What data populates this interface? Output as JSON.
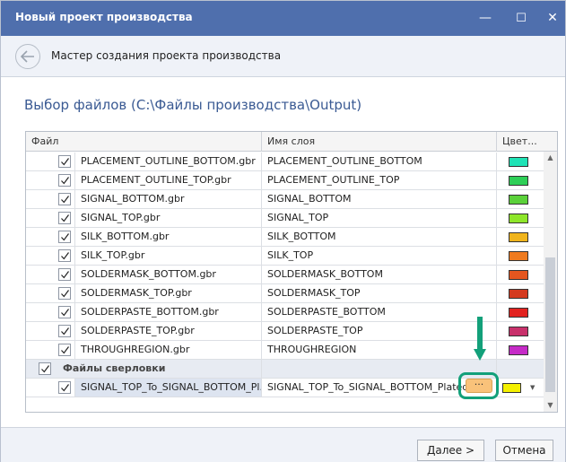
{
  "window": {
    "title": "Новый проект производства",
    "minimize": "—",
    "maximize": "☐",
    "close": "✕"
  },
  "header": {
    "title": "Мастер создания проекта производства"
  },
  "section": {
    "title": "Выбор файлов (C:\\Файлы производства\\Output)"
  },
  "grid": {
    "columns": [
      "Файл",
      "Имя слоя",
      "Цвет..."
    ],
    "rows": [
      {
        "file": "PLACEMENT_OUTLINE_BOTTOM.gbr",
        "layer": "PLACEMENT_OUTLINE_BOTTOM",
        "color": "#1fe3b6",
        "checked": true
      },
      {
        "file": "PLACEMENT_OUTLINE_TOP.gbr",
        "layer": "PLACEMENT_OUTLINE_TOP",
        "color": "#2ecf57",
        "checked": true
      },
      {
        "file": "SIGNAL_BOTTOM.gbr",
        "layer": "SIGNAL_BOTTOM",
        "color": "#5bd13a",
        "checked": true
      },
      {
        "file": "SIGNAL_TOP.gbr",
        "layer": "SIGNAL_TOP",
        "color": "#8ee62a",
        "checked": true
      },
      {
        "file": "SILK_BOTTOM.gbr",
        "layer": "SILK_BOTTOM",
        "color": "#f0b41c",
        "checked": true
      },
      {
        "file": "SILK_TOP.gbr",
        "layer": "SILK_TOP",
        "color": "#ef7a1e",
        "checked": true
      },
      {
        "file": "SOLDERMASK_BOTTOM.gbr",
        "layer": "SOLDERMASK_BOTTOM",
        "color": "#e5561f",
        "checked": true
      },
      {
        "file": "SOLDERMASK_TOP.gbr",
        "layer": "SOLDERMASK_TOP",
        "color": "#d43a1f",
        "checked": true
      },
      {
        "file": "SOLDERPASTE_BOTTOM.gbr",
        "layer": "SOLDERPASTE_BOTTOM",
        "color": "#e2221f",
        "checked": true
      },
      {
        "file": "SOLDERPASTE_TOP.gbr",
        "layer": "SOLDERPASTE_TOP",
        "color": "#c8306b",
        "checked": true
      },
      {
        "file": "THROUGHREGION.gbr",
        "layer": "THROUGHREGION",
        "color": "#c52bc7",
        "checked": true
      }
    ],
    "group": {
      "label": "Файлы сверловки",
      "checked": true
    },
    "drill_row": {
      "file": "SIGNAL_TOP_To_SIGNAL_BOTTOM_Pl...",
      "layer": "SIGNAL_TOP_To_SIGNAL_BOTTOM_Plated",
      "ellipsis": "···",
      "color": "#f4f000",
      "checked": true,
      "dropdown": "▼"
    }
  },
  "footer": {
    "next_label": "Далее >",
    "cancel_label": "Отмена"
  },
  "colors": {
    "titlebar": "#4f6fad",
    "accent_text": "#3a5a93",
    "highlight": "#13a07a",
    "ellipsis_button": "#f9c27a"
  }
}
